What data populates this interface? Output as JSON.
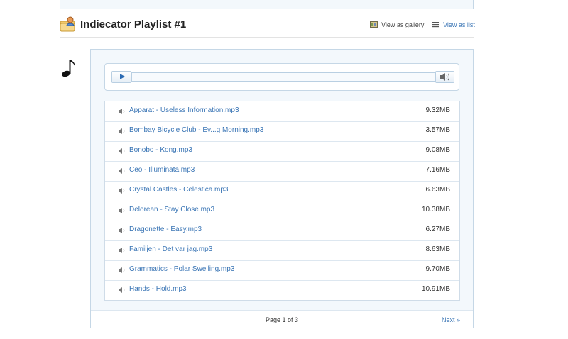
{
  "header": {
    "title": "Indiecator Playlist #1",
    "view_gallery": "View as gallery",
    "view_list": "View as list"
  },
  "icons": {
    "playlist": "playlist-folder-icon",
    "music": "music-note-icon",
    "gallery": "gallery-view-icon",
    "list": "list-view-icon",
    "play": "play-icon",
    "volume": "volume-icon",
    "track": "audio-file-icon"
  },
  "colors": {
    "link": "#3a75b5",
    "panel_border": "#c5d7e6",
    "panel_bg": "#f3f8fc"
  },
  "tracks": [
    {
      "name": "Apparat - Useless Information.mp3",
      "size": "9.32MB"
    },
    {
      "name": "Bombay Bicycle Club - Ev...g Morning.mp3",
      "size": "3.57MB"
    },
    {
      "name": "Bonobo - Kong.mp3",
      "size": "9.08MB"
    },
    {
      "name": "Ceo - Illuminata.mp3",
      "size": "7.16MB"
    },
    {
      "name": "Crystal Castles - Celestica.mp3",
      "size": "6.63MB"
    },
    {
      "name": "Delorean - Stay Close.mp3",
      "size": "10.38MB"
    },
    {
      "name": "Dragonette - Easy.mp3",
      "size": "6.27MB"
    },
    {
      "name": "Familjen - Det var jag.mp3",
      "size": "8.63MB"
    },
    {
      "name": "Grammatics - Polar Swelling.mp3",
      "size": "9.70MB"
    },
    {
      "name": "Hands - Hold.mp3",
      "size": "10.91MB"
    }
  ],
  "pagination": {
    "label": "Page 1 of 3",
    "next": "Next »"
  }
}
